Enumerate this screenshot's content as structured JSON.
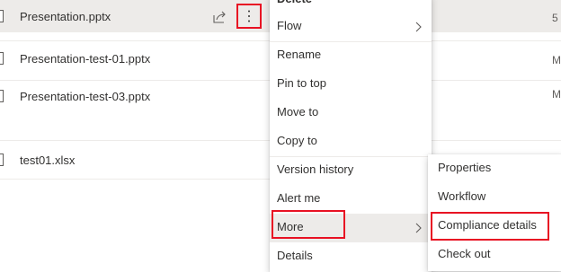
{
  "files": [
    {
      "name": "Presentation.pptx",
      "meta": "5",
      "selected": true
    },
    {
      "name": "Presentation-test-01.pptx",
      "meta": "M"
    },
    {
      "name": "Presentation-test-03.pptx",
      "meta": "M"
    },
    {
      "name": "test01.xlsx",
      "meta": ""
    }
  ],
  "context_menu": {
    "top_partial": "Delete",
    "items": [
      "Flow",
      "Rename",
      "Pin to top",
      "Move to",
      "Copy to",
      "Version history",
      "Alert me",
      "More",
      "Details"
    ]
  },
  "submenu": {
    "items": [
      "Properties",
      "Workflow",
      "Compliance details",
      "Check out"
    ]
  },
  "colors": {
    "highlight_border": "#e81123",
    "selected_row": "#edebe9",
    "hover_item": "#edebe9",
    "text": "#323130"
  },
  "icons": {
    "share": "share-icon",
    "more": "more-vertical-icon",
    "chevron": "chevron-right-icon",
    "file": "file-icon"
  }
}
